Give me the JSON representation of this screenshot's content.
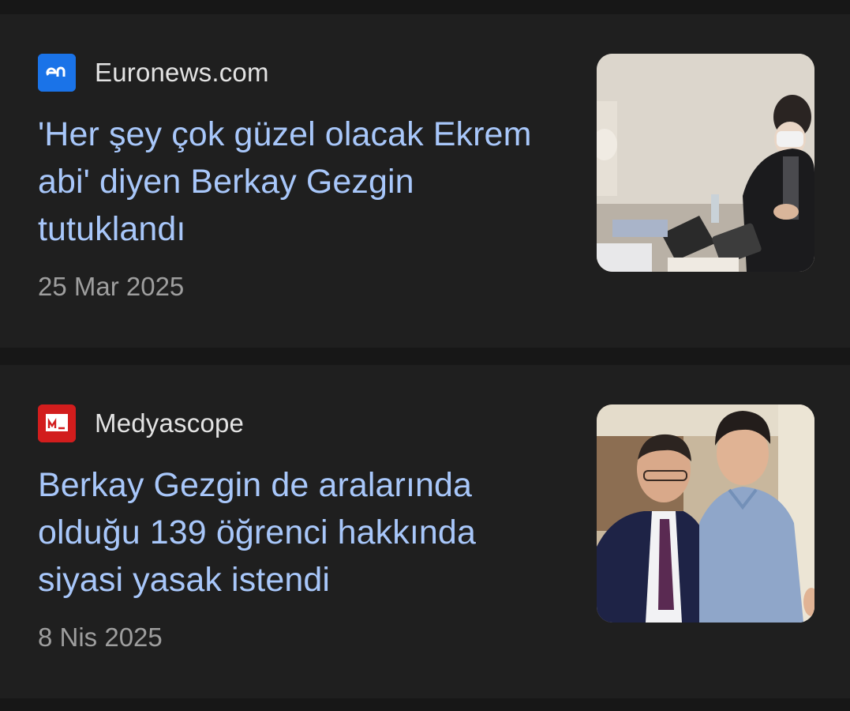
{
  "articles": [
    {
      "source": "Euronews.com",
      "logo_icon": "euronews-logo-icon",
      "logo_color": "#1a73e8",
      "headline": "'Her şey çok güzel olacak Ekrem abi' diyen Berkay Gezgin tutuklandı",
      "date": "25 Mar 2025",
      "thumbnail": "office-desk-photo"
    },
    {
      "source": "Medyascope",
      "logo_icon": "medyascope-logo-icon",
      "logo_color": "#d21d1d",
      "headline": "Berkay Gezgin de aralarında olduğu 139 öğrenci hakkında siyasi yasak istendi",
      "date": "8 Nis 2025",
      "thumbnail": "two-men-portrait-photo"
    }
  ],
  "colors": {
    "background": "#1f1f1f",
    "divider": "#171717",
    "headline": "#a8c7fa",
    "source": "#e3e3e3",
    "date": "#9e9e9e"
  }
}
